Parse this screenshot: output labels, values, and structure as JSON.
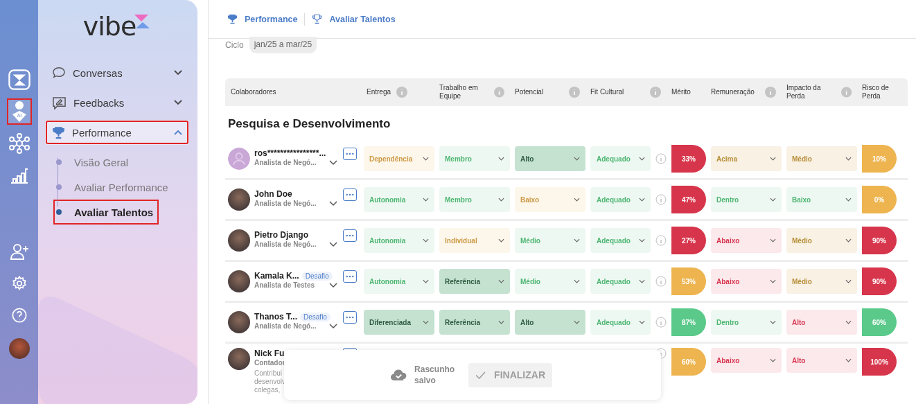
{
  "rail": [
    {
      "selected": false,
      "highlighted": false
    },
    {
      "selected": true,
      "highlighted": true,
      "label": "AI"
    },
    {
      "selected": false,
      "highlighted": false
    },
    {
      "selected": false,
      "highlighted": false
    },
    {
      "selected": false,
      "highlighted": false
    },
    {
      "selected": false,
      "highlighted": false
    },
    {
      "selected": false,
      "highlighted": false
    }
  ],
  "logo": "vibe",
  "menu": [
    {
      "label": "Conversas",
      "kind": "chat",
      "expanded": false,
      "selected": false,
      "highlighted": false
    },
    {
      "label": "Feedbacks",
      "kind": "feedback",
      "expanded": false,
      "selected": false,
      "highlighted": false
    },
    {
      "label": "Performance",
      "kind": "trophy",
      "expanded": true,
      "selected": true,
      "highlighted": true,
      "children": [
        {
          "label": "Visão Geral",
          "selected": false,
          "highlighted": false
        },
        {
          "label": "Avaliar Performance",
          "selected": false,
          "highlighted": false
        },
        {
          "label": "Avaliar Talentos",
          "selected": true,
          "highlighted": true
        }
      ]
    }
  ],
  "breadcrumb": [
    "Performance",
    "Avaliar Talentos"
  ],
  "cycle": {
    "label": "Ciclo",
    "value": "jan/25 a mar/25"
  },
  "columns": [
    {
      "label": "Colaboradores",
      "info": false
    },
    {
      "label": "Entrega",
      "info": true
    },
    {
      "label": "Trabalho em Equipe",
      "info": true
    },
    {
      "label": "Potencial",
      "info": true
    },
    {
      "label": "Fit Cultural",
      "info": true
    },
    {
      "label": "Mérito",
      "info": false
    },
    {
      "label": "Remuneração",
      "info": true
    },
    {
      "label": "Impacto da Perda",
      "info": true
    },
    {
      "label": "Risco de Perda",
      "info": false
    }
  ],
  "group": "Pesquisa e Desenvolvimento",
  "rows": [
    {
      "kind": "placeholder",
      "name": "ros****************...",
      "role": "Analista de Negó...",
      "ratings": [
        {
          "value": "Dependência",
          "kind": "warn"
        },
        {
          "value": "Membro",
          "kind": "good"
        },
        {
          "value": "Alto",
          "kind": "great"
        }
      ],
      "fit": {
        "value": "Adequado",
        "kind": "good"
      },
      "merit": {
        "value": "33%",
        "color": "#d7354b"
      },
      "pay": {
        "value": "Acima",
        "kind": "mid"
      },
      "impact": {
        "value": "Médio",
        "kind": "mid"
      },
      "risk": {
        "value": "10%",
        "color": "#edb44f"
      }
    },
    {
      "kind": "photo",
      "name": "John Doe",
      "role": "Analista de Negó...",
      "ratings": [
        {
          "value": "Autonomia",
          "kind": "good"
        },
        {
          "value": "Membro",
          "kind": "good"
        },
        {
          "value": "Baixo",
          "kind": "warn"
        }
      ],
      "fit": {
        "value": "Adequado",
        "kind": "good"
      },
      "merit": {
        "value": "47%",
        "color": "#d7354b"
      },
      "pay": {
        "value": "Dentro",
        "kind": "good"
      },
      "impact": {
        "value": "Baixo",
        "kind": "good"
      },
      "risk": {
        "value": "0%",
        "color": "#edb44f"
      }
    },
    {
      "kind": "photo",
      "name": "Pietro Django",
      "role": "Analista de Negó...",
      "ratings": [
        {
          "value": "Autonomia",
          "kind": "good"
        },
        {
          "value": "Individual",
          "kind": "warn"
        },
        {
          "value": "Médio",
          "kind": "good"
        }
      ],
      "fit": {
        "value": "Adequado",
        "kind": "good"
      },
      "merit": {
        "value": "27%",
        "color": "#d7354b"
      },
      "pay": {
        "value": "Abaixo",
        "kind": "bad"
      },
      "impact": {
        "value": "Médio",
        "kind": "mid"
      },
      "risk": {
        "value": "90%",
        "color": "#d7354b"
      }
    },
    {
      "kind": "photo",
      "name": "Kamala K...",
      "badge": "Desafio",
      "role": "Analista de Testes",
      "ratings": [
        {
          "value": "Autonomia",
          "kind": "good"
        },
        {
          "value": "Referência",
          "kind": "great"
        },
        {
          "value": "Médio",
          "kind": "good"
        }
      ],
      "fit": {
        "value": "Adequado",
        "kind": "good"
      },
      "merit": {
        "value": "53%",
        "color": "#edb44f"
      },
      "pay": {
        "value": "Abaixo",
        "kind": "bad"
      },
      "impact": {
        "value": "Médio",
        "kind": "mid"
      },
      "risk": {
        "value": "90%",
        "color": "#d7354b"
      }
    },
    {
      "kind": "photo",
      "name": "Thanos T...",
      "badge": "Desafio",
      "role": "Analista de Negó...",
      "ratings": [
        {
          "value": "Diferenciada",
          "kind": "great"
        },
        {
          "value": "Referência",
          "kind": "great"
        },
        {
          "value": "Alto",
          "kind": "great"
        }
      ],
      "fit": {
        "value": "Adequado",
        "kind": "good"
      },
      "merit": {
        "value": "87%",
        "color": "#5ac98a"
      },
      "pay": {
        "value": "Dentro",
        "kind": "good"
      },
      "impact": {
        "value": "Alto",
        "kind": "bad"
      },
      "risk": {
        "value": "60%",
        "color": "#5ac98a"
      }
    },
    {
      "kind": "photo",
      "name": "Nick Fu",
      "role": "Contador",
      "description": [
        "Contribui",
        "desenvolv",
        "colegas,"
      ],
      "merit": {
        "value": "60%",
        "color": "#edb44f"
      },
      "pay": {
        "value": "Abaixo",
        "kind": "bad"
      },
      "impact": {
        "value": "Alto",
        "kind": "bad"
      },
      "risk": {
        "value": "100%",
        "color": "#d7354b"
      }
    }
  ],
  "toast": {
    "status": "Rascunho salvo",
    "button": {
      "label": "FINALIZAR",
      "disabled": true
    }
  }
}
